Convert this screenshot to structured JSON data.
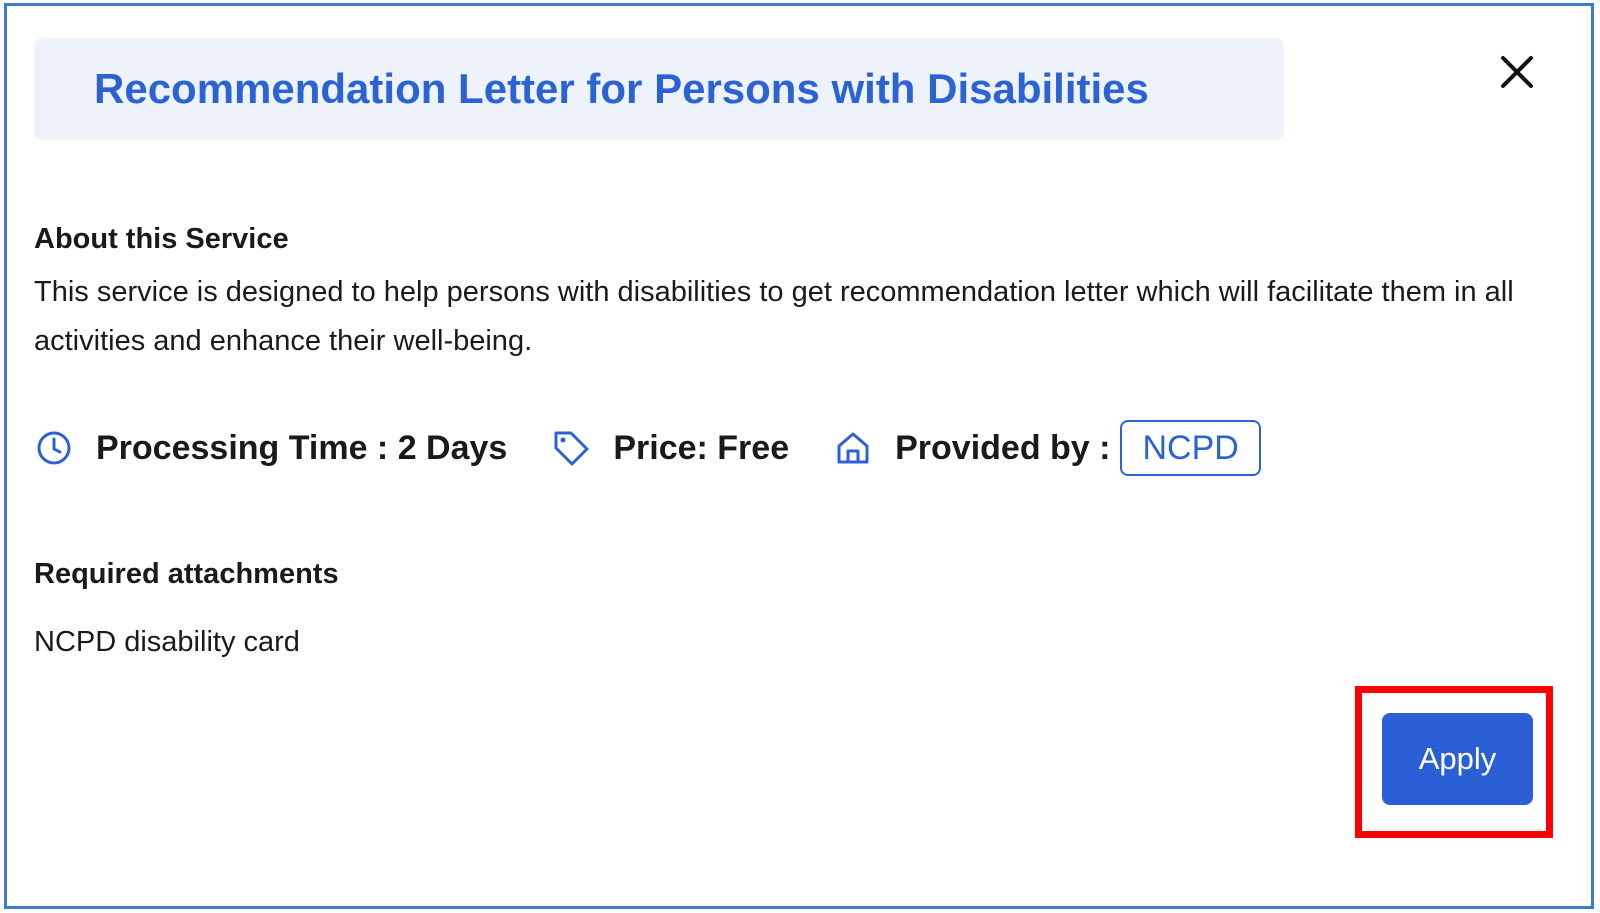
{
  "modal": {
    "title": "Recommendation Letter for Persons with Disabilities",
    "close_icon": "close-icon"
  },
  "about": {
    "heading": "About this Service",
    "text": "This service is designed to help persons with disabilities to get recommendation letter which will facilitate them in all activities and enhance their well-being."
  },
  "meta": {
    "processing_time": "Processing Time : 2 Days",
    "price": "Price: Free",
    "provided_by_label": "Provided by :",
    "provider": "NCPD",
    "icons": [
      "clock-icon",
      "tag-icon",
      "home-icon"
    ]
  },
  "attachments": {
    "heading": "Required attachments",
    "items": [
      "NCPD disability card"
    ]
  },
  "actions": {
    "apply_label": "Apply"
  },
  "colors": {
    "accent": "#2b62d4",
    "title_bg": "#eef3fb",
    "button_bg": "#2b5fd6",
    "highlight": "#ff0000",
    "modal_border": "#3d7bd0"
  }
}
